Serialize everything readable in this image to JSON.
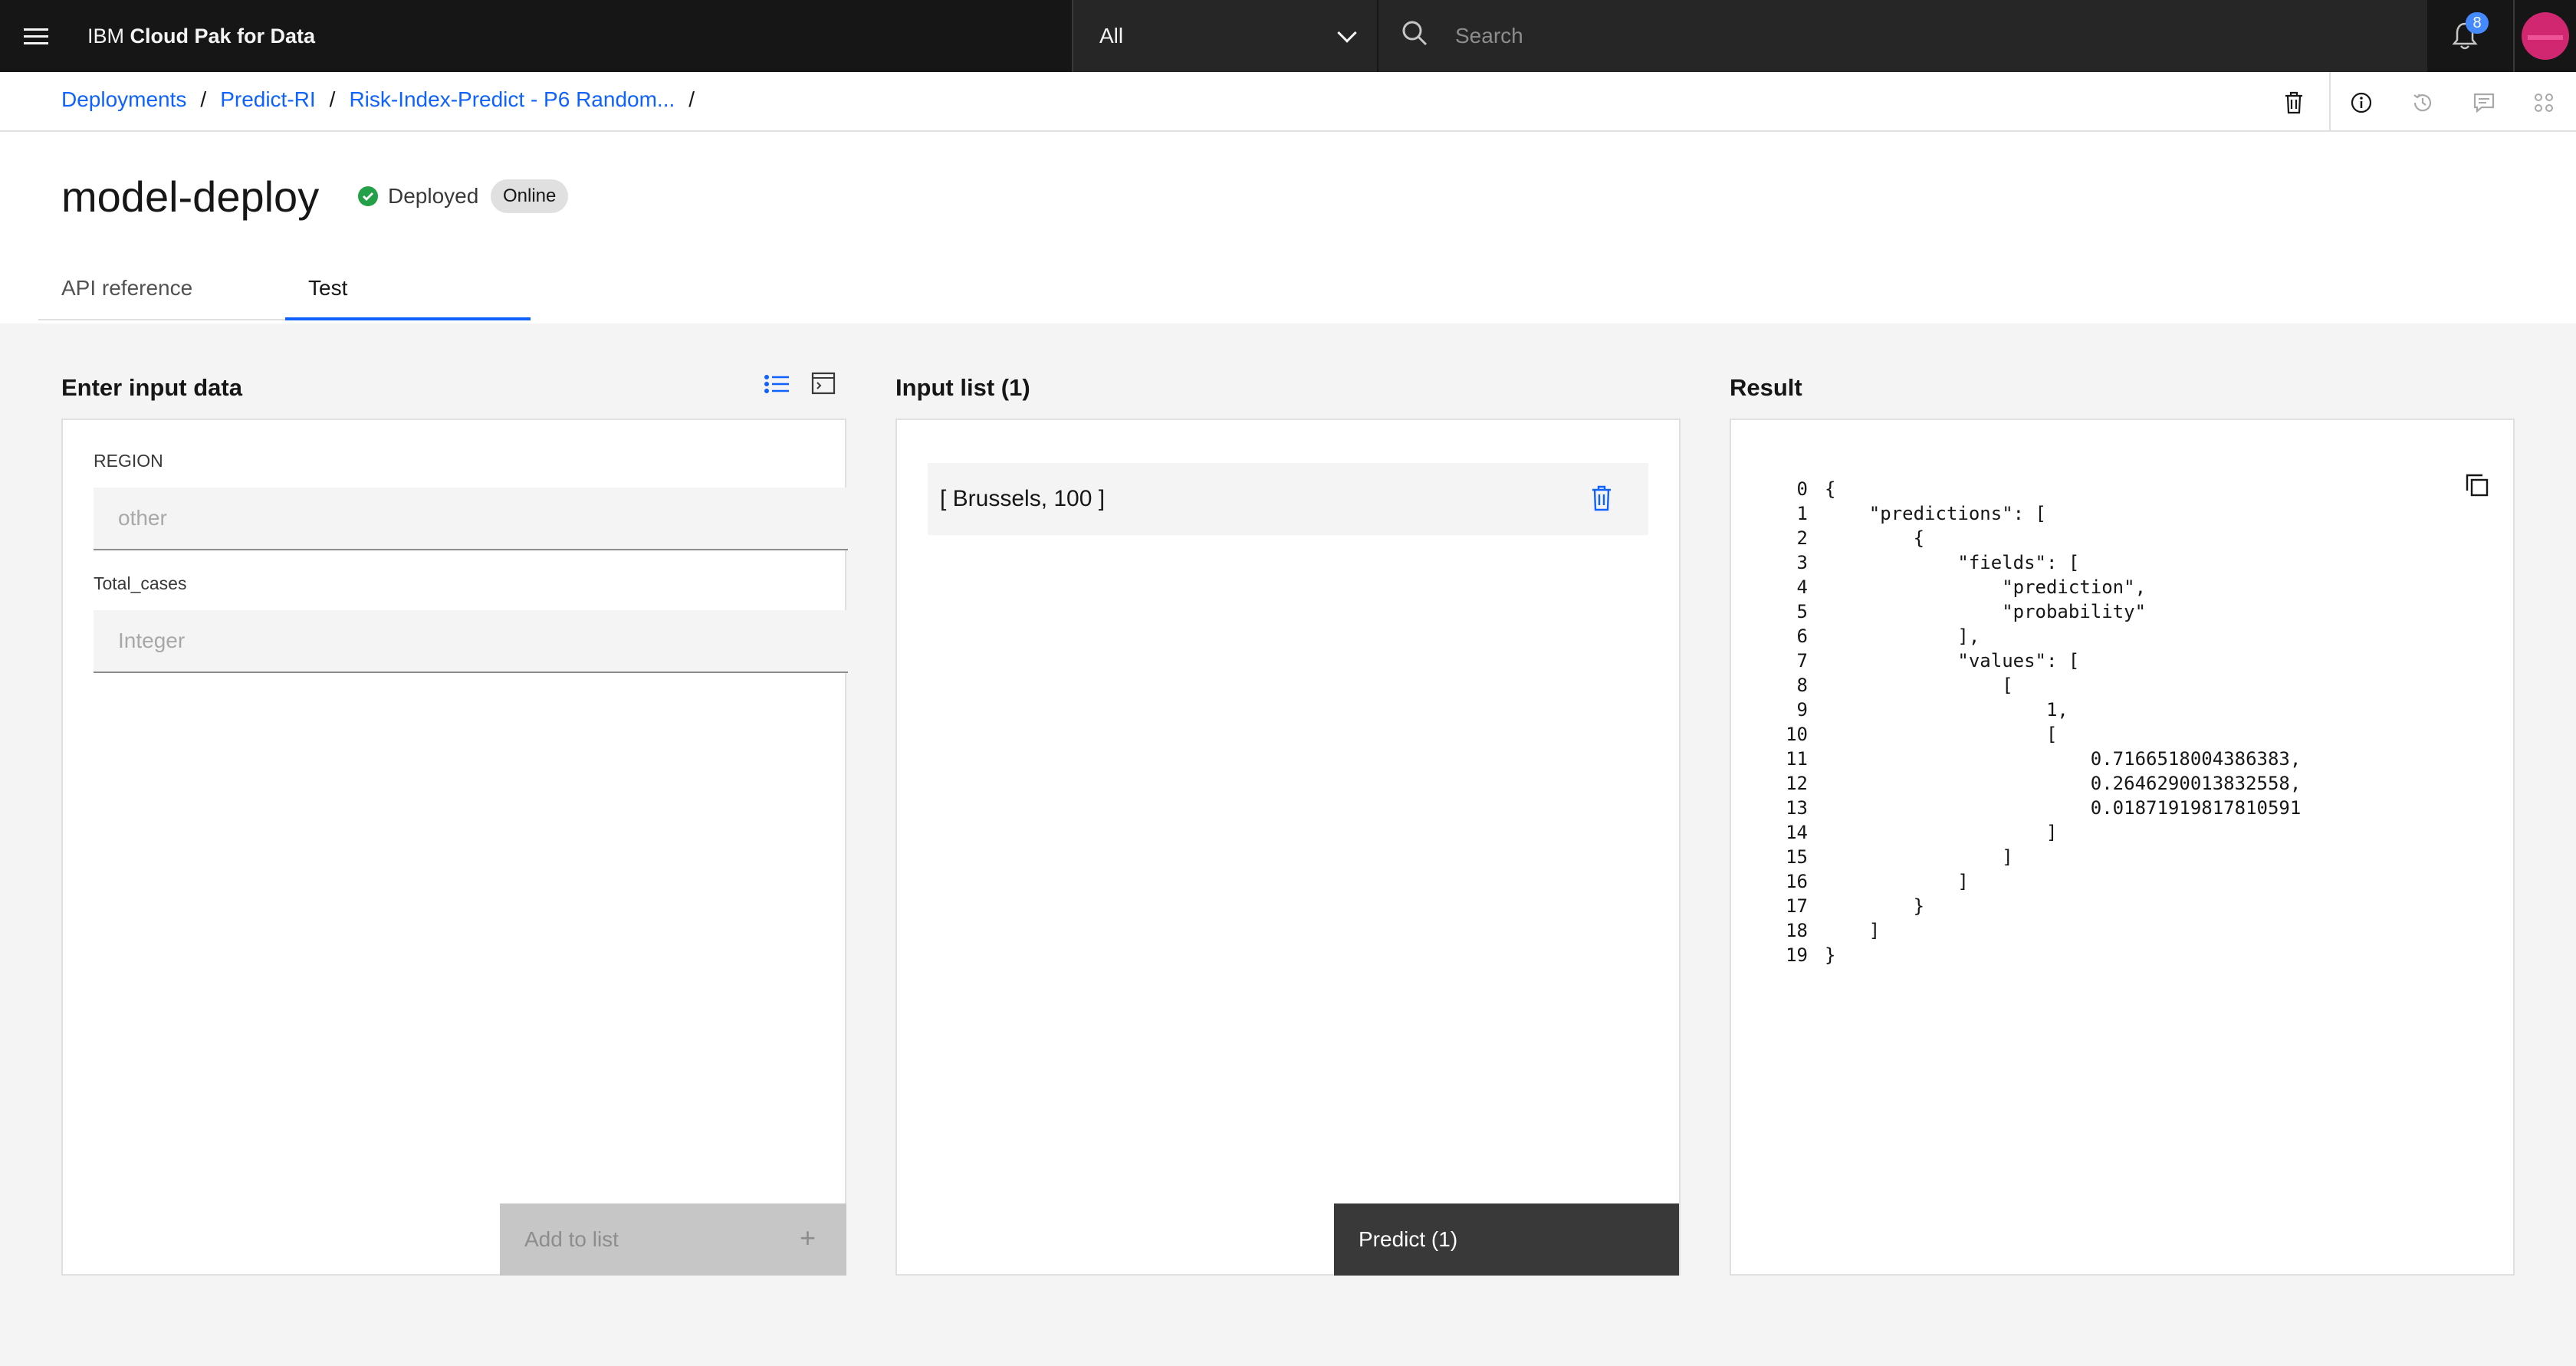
{
  "topbar": {
    "brand_prefix": "IBM",
    "brand_name": "Cloud Pak for Data",
    "scope_value": "All",
    "search_placeholder": "Search",
    "notification_count": "8"
  },
  "breadcrumbs": [
    "Deployments",
    "Predict-RI",
    "Risk-Index-Predict - P6 Random..."
  ],
  "breadcrumb_sep": "/",
  "page": {
    "title": "model-deploy",
    "status": "Deployed",
    "tag": "Online"
  },
  "tabs": [
    {
      "label": "API reference",
      "active": false
    },
    {
      "label": "Test",
      "active": true
    }
  ],
  "input_panel": {
    "title": "Enter input data",
    "fields": [
      {
        "label": "REGION",
        "placeholder": "other"
      },
      {
        "label": "Total_cases",
        "placeholder": "Integer"
      }
    ],
    "add_button": "Add to list",
    "add_icon": "+"
  },
  "list_panel": {
    "title": "Input list (1)",
    "items": [
      "[ Brussels, 100 ]"
    ],
    "predict_button": "Predict (1)"
  },
  "result_panel": {
    "title": "Result",
    "lines": [
      "{",
      "    \"predictions\": [",
      "        {",
      "            \"fields\": [",
      "                \"prediction\",",
      "                \"probability\"",
      "            ],",
      "            \"values\": [",
      "                [",
      "                    1,",
      "                    [",
      "                        0.7166518004386383,",
      "                        0.2646290013832558,",
      "                        0.01871919817810591",
      "                    ]",
      "                ]",
      "            ]",
      "        }",
      "    ]",
      "}"
    ]
  },
  "colors": {
    "accent": "#0f62fe",
    "status_ok": "#24a148",
    "avatar": "#d12771"
  }
}
